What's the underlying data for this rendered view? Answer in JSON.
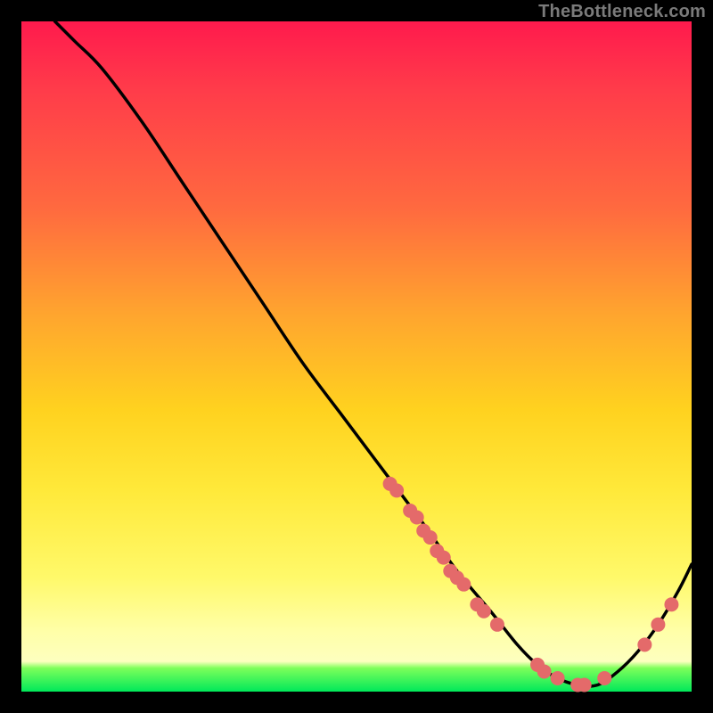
{
  "attribution": "TheBottleneck.com",
  "colors": {
    "background": "#000000",
    "curve": "#000000",
    "marker": "#e46a6a",
    "gradient_stops": [
      "#ff1a4d",
      "#ff3b4a",
      "#ff6a3f",
      "#ffa62e",
      "#ffd21f",
      "#ffe93a",
      "#fff96a",
      "#ffffa8",
      "#fdffbf",
      "#7dff5a",
      "#00e85a"
    ]
  },
  "chart_data": {
    "type": "line",
    "title": "",
    "xlabel": "",
    "ylabel": "",
    "xlim": [
      0,
      100
    ],
    "ylim": [
      0,
      100
    ],
    "grid": false,
    "legend": false,
    "series": [
      {
        "name": "curve",
        "x": [
          5,
          8,
          12,
          18,
          24,
          30,
          36,
          42,
          48,
          54,
          60,
          65,
          70,
          74,
          77,
          80,
          83,
          86,
          89,
          92,
          95,
          98,
          100
        ],
        "y": [
          100,
          97,
          93,
          85,
          76,
          67,
          58,
          49,
          41,
          33,
          25,
          18,
          12,
          7,
          4,
          2,
          1,
          1,
          3,
          6,
          10,
          15,
          19
        ]
      }
    ],
    "markers": [
      {
        "x": 55,
        "y": 31
      },
      {
        "x": 56,
        "y": 30
      },
      {
        "x": 58,
        "y": 27
      },
      {
        "x": 59,
        "y": 26
      },
      {
        "x": 60,
        "y": 24
      },
      {
        "x": 61,
        "y": 23
      },
      {
        "x": 62,
        "y": 21
      },
      {
        "x": 63,
        "y": 20
      },
      {
        "x": 64,
        "y": 18
      },
      {
        "x": 65,
        "y": 17
      },
      {
        "x": 66,
        "y": 16
      },
      {
        "x": 68,
        "y": 13
      },
      {
        "x": 69,
        "y": 12
      },
      {
        "x": 71,
        "y": 10
      },
      {
        "x": 77,
        "y": 4
      },
      {
        "x": 78,
        "y": 3
      },
      {
        "x": 80,
        "y": 2
      },
      {
        "x": 83,
        "y": 1
      },
      {
        "x": 84,
        "y": 1
      },
      {
        "x": 87,
        "y": 2
      },
      {
        "x": 93,
        "y": 7
      },
      {
        "x": 95,
        "y": 10
      },
      {
        "x": 97,
        "y": 13
      }
    ]
  }
}
